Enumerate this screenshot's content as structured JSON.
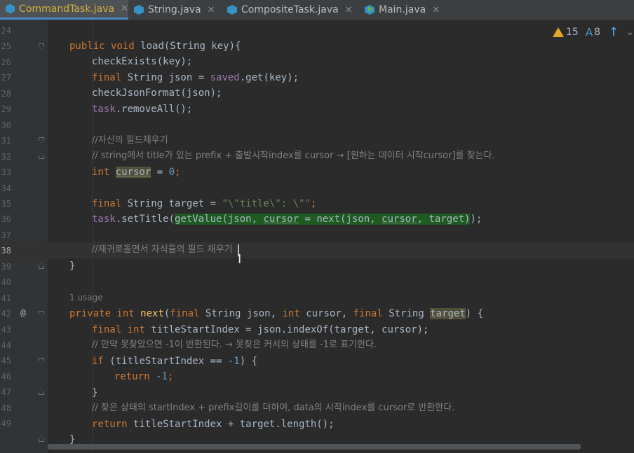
{
  "tabs": [
    {
      "label": "CommandTask.java",
      "active": true,
      "icon": "java-class-icon"
    },
    {
      "label": "String.java",
      "active": false,
      "icon": "java-class-icon"
    },
    {
      "label": "CompositeTask.java",
      "active": false,
      "icon": "java-class-icon"
    },
    {
      "label": "Main.java",
      "active": false,
      "icon": "java-main-class-icon"
    }
  ],
  "inspection": {
    "warnings": "15",
    "typos": "8"
  },
  "usage_hint": "1 usage",
  "line_numbers": [
    "24",
    "25",
    "26",
    "27",
    "28",
    "29",
    "30",
    "31",
    "32",
    "33",
    "34",
    "35",
    "36",
    "37",
    "38",
    "39",
    "40",
    "41",
    "42",
    "43",
    "44",
    "45",
    "46",
    "47",
    "48",
    "49"
  ],
  "code": {
    "l25": {
      "a": "public void ",
      "b": "load",
      "c": "(String key){"
    },
    "l26": {
      "a": "checkExists(key);"
    },
    "l27": {
      "a": "final ",
      "b": "String json = ",
      "c": "saved",
      ".d": "",
      "d": ".get(key);"
    },
    "l28": {
      "a": "checkJsonFormat(json);"
    },
    "l29": {
      "a": "task",
      ".b": "",
      "b": ".removeAll();"
    },
    "l31": {
      "a": "//자신의 필드채우기"
    },
    "l32": {
      "a": "// string에서 title가 있는 prefix + 출발시작index를 cursor → [원하는 데이터 시작cursor]를 찾는다."
    },
    "l33": {
      "a": "int ",
      "b": "cursor",
      "c": " = ",
      "d": "0",
      ".e": "",
      "e": ";"
    },
    "l35": {
      "a": "final ",
      "b": "String target = ",
      "c": "\"\\\"title\\\": \\\"\"",
      "d": ";"
    },
    "l36": {
      "a": "task",
      ".b": "",
      "b": ".setTitle(",
      "c": "getValue(json, ",
      "d": "cursor",
      "e": " = next(json, ",
      "f": "cursor",
      "g": ", target)",
      "h": ");"
    },
    "l38": {
      "a": "//재귀로돌면서 자식들의 필드 채우기"
    },
    "l39": {
      "a": "}"
    },
    "l41": {
      "a": "private int ",
      "b": "next",
      "c": "(",
      "d": "final ",
      "e": "String json, ",
      "f": "int ",
      "g": "cursor, ",
      "h": "final ",
      "i": "String ",
      "j": "target",
      ".k": "",
      "k": ") {"
    },
    "l42": {
      "a": "final int ",
      "b": "titleStartIndex = json.indexOf(target, cursor);"
    },
    "l43": {
      "a": "// 만약 못찾았으면 -1이 반환된다. → 못찾은 커서의 상태를 -1로 표기한다."
    },
    "l44": {
      "a": "if ",
      "b": "(titleStartIndex == ",
      "c": "-1",
      ".d": "",
      "d": ") {"
    },
    "l45": {
      "a": "return ",
      "b": "-1",
      ".c": "",
      "c": ";"
    },
    "l46": {
      "a": "}"
    },
    "l47": {
      "a": "// 찾은 상태의 startIndex + prefix길이를 더하여, data의 시작index를 cursor로 반환한다."
    },
    "l48": {
      "a": "return ",
      "b": "titleStartIndex + target.length();"
    },
    "l49": {
      "a": "}"
    }
  },
  "colors": {
    "keyword": "#cc7832",
    "method_decl": "#ffc66d",
    "field": "#9876aa",
    "number": "#6897bb",
    "string": "#6a8759",
    "comment": "#808080",
    "text": "#a9b7c6"
  }
}
